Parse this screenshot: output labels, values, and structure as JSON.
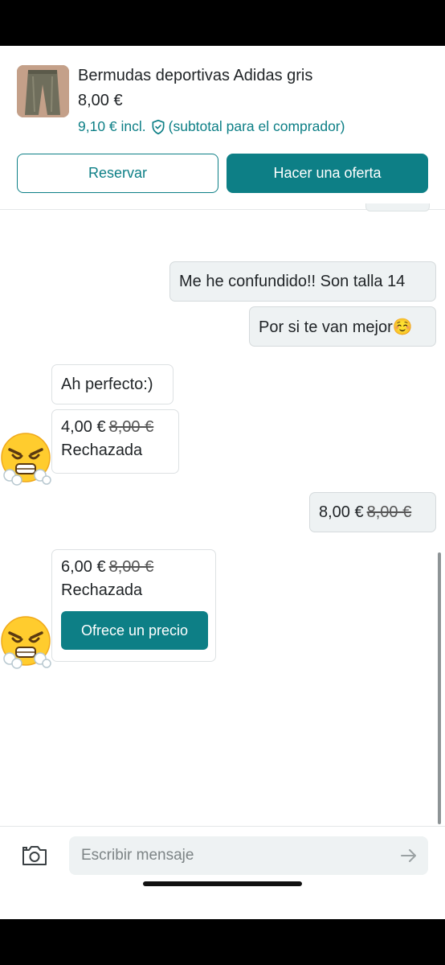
{
  "product": {
    "title": "Bermudas deportivas Adidas gris",
    "price": "8,00 €",
    "incl_price": "9,10 € incl.",
    "incl_note": "(subtotal para el comprador)",
    "thumb_icon": "pants-photo",
    "reserve_label": "Reservar",
    "offer_label": "Hacer una oferta"
  },
  "messages": [
    {
      "dir": "out",
      "text": "Me he confundido!! Son talla 14"
    },
    {
      "dir": "out",
      "text": "Por si te van mejor☺️"
    },
    {
      "dir": "in",
      "text": "Ah perfecto:)"
    },
    {
      "dir": "in",
      "type": "offer",
      "amount": "4,00 €",
      "original": "8,00 €",
      "status": "Rechazada",
      "avatar": "😤"
    },
    {
      "dir": "out",
      "type": "offer",
      "amount": "8,00 €",
      "original": "8,00 €"
    },
    {
      "dir": "in",
      "type": "offer",
      "amount": "6,00 €",
      "original": "8,00 €",
      "status": "Rechazada",
      "action_label": "Ofrece un precio",
      "avatar": "😤"
    }
  ],
  "composer": {
    "placeholder": "Escribir mensaje",
    "camera_icon": "camera-icon",
    "send_icon": "arrow-right-icon"
  },
  "colors": {
    "accent": "#0d7f86",
    "bubble_out": "#eef2f3",
    "bubble_in": "#ffffff"
  }
}
